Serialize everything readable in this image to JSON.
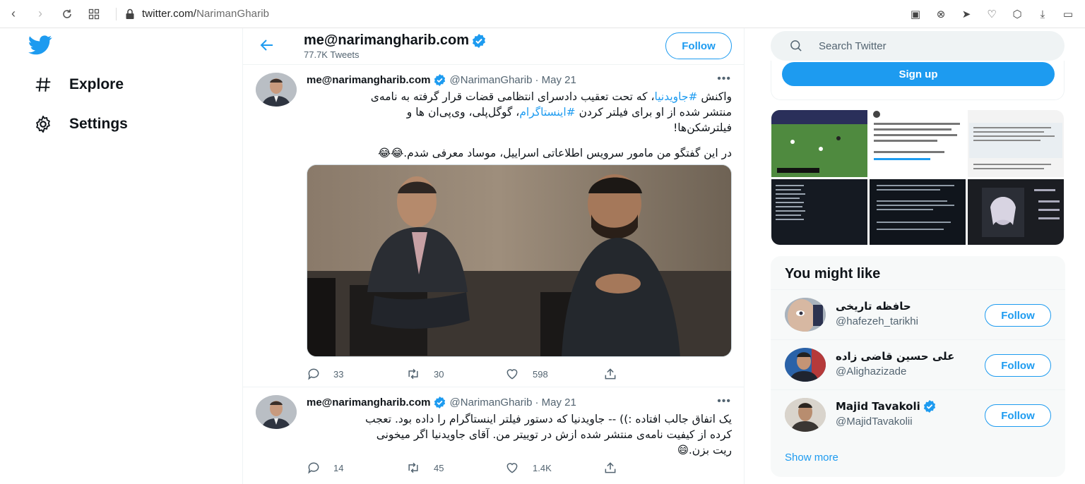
{
  "browser": {
    "url_host": "twitter.com/",
    "url_path": "NarimanGharib"
  },
  "nav": {
    "items": [
      {
        "label": "Explore",
        "icon": "hash-icon"
      },
      {
        "label": "Settings",
        "icon": "gear-icon"
      }
    ]
  },
  "profile_header": {
    "name": "me@narimangharib.com",
    "tweet_count": "77.7K Tweets",
    "follow_label": "Follow"
  },
  "tweets": [
    {
      "name": "me@narimangharib.com",
      "handle": "@NarimanGharib",
      "date": "· May 21",
      "text_line1_a": "واکنش ",
      "text_line1_tag": "#جاویدنیا",
      "text_line1_b": "، که تحت تعقیب دادسرای انتظامی قضات قرار گرفته به نامه‌ی",
      "text_line2_a": "منتشر شده از او برای فیلتر کردن ",
      "text_line2_tag": "#اینستاگرام",
      "text_line2_b": "، گوگل‌پلی، وی‌پی‌ان ها و",
      "text_line3": "فیلترشکن‌ها!",
      "text_line4": "در این گفتگو من مامور سرویس اطلاعاتی اسراییل، موساد معرفی شدم.😂😂",
      "replies": "33",
      "retweets": "30",
      "likes": "598"
    },
    {
      "name": "me@narimangharib.com",
      "handle": "@NarimanGharib",
      "date": "· May 21",
      "text_line1": "یک اتفاق جالب افتاده :)) -- جاویدنیا که دستور فیلتر اینستاگرام را داده بود. تعجب",
      "text_line2": "کرده از کیفیت نامه‌ی منتشر شده ازش در توییتر من. آقای جاویدنیا اگر میخونی",
      "text_line3": "ریت بزن.😄",
      "replies": "14",
      "retweets": "45",
      "likes": "1.4K"
    }
  ],
  "sidebar": {
    "search_placeholder": "Search Twitter",
    "signup_label": "Sign up",
    "who_to_follow": {
      "title": "You might like",
      "accounts": [
        {
          "name": "حافظه تاریخی",
          "handle": "@hafezeh_tarikhi",
          "verified": false,
          "follow_label": "Follow"
        },
        {
          "name": "علی حسین قاضی زاده",
          "handle": "@Alighazizade",
          "verified": false,
          "follow_label": "Follow"
        },
        {
          "name": "Majid Tavakoli",
          "handle": "@MajidTavakolii",
          "verified": true,
          "follow_label": "Follow"
        }
      ],
      "show_more": "Show more"
    }
  },
  "colors": {
    "accent": "#1d9bf0",
    "text_primary": "#0f1419",
    "text_secondary": "#536471"
  }
}
